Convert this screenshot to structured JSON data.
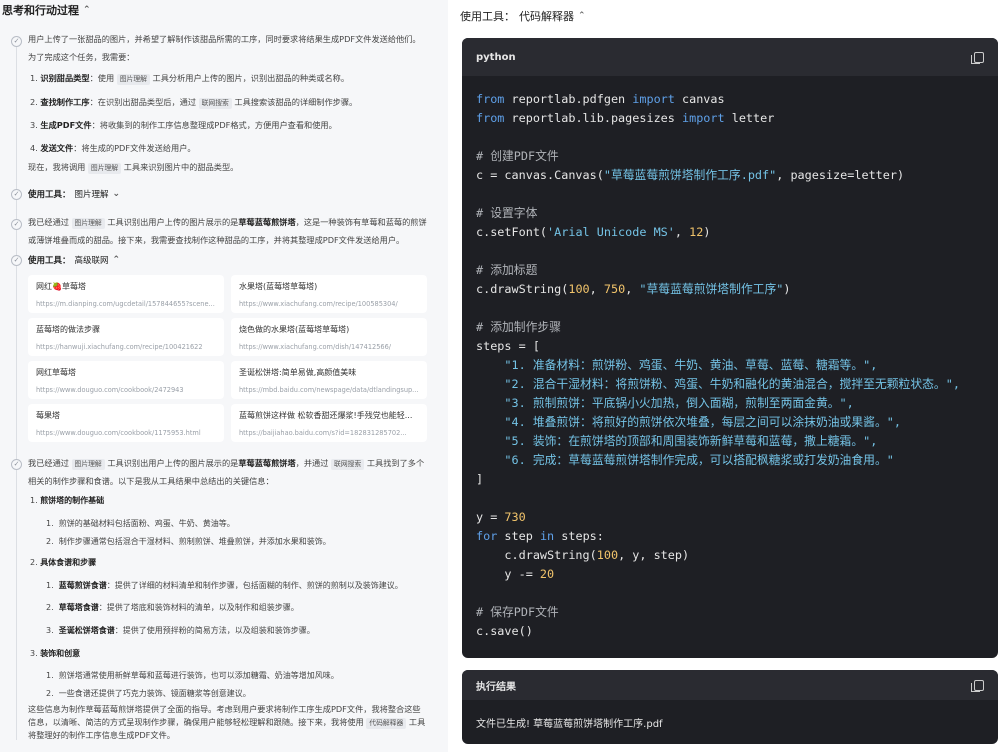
{
  "left": {
    "header": "思考和行动过程",
    "intro": {
      "p1": "用户上传了一张甜品的图片，并希望了解制作该甜品所需的工序，同时要求将结果生成PDF文件发送给他们。",
      "p2": "为了完成这个任务，我需要：",
      "items": [
        {
          "n": "1.",
          "title": "识别甜品类型",
          "pre": "：使用 ",
          "tool": "图片理解",
          "post": " 工具分析用户上传的图片，识别出甜品的种类或名称。"
        },
        {
          "n": "2.",
          "title": "查找制作工序",
          "pre": "：在识别出甜品类型后，通过 ",
          "tool": "联网搜索",
          "post": " 工具搜索该甜品的详细制作步骤。"
        },
        {
          "n": "3.",
          "title": "生成PDF文件",
          "pre": "：将收集到的制作工序信息整理成PDF格式，方便用户查看和使用。",
          "tool": "",
          "post": ""
        },
        {
          "n": "4.",
          "title": "发送文件",
          "pre": "：将生成的PDF文件发送给用户。",
          "tool": "",
          "post": ""
        }
      ],
      "p3_pre": "现在，我将调用 ",
      "p3_tool": "图片理解",
      "p3_post": " 工具来识别图片中的甜品类型。"
    },
    "tool1": {
      "label": "使用工具：",
      "name": "图片理解"
    },
    "recog": {
      "pre": "我已经通过 ",
      "tool": "图片理解",
      "mid": " 工具识别出用户上传的图片展示的是",
      "bold": "草莓蓝莓煎饼塔",
      "post": "，这是一种装饰有草莓和蓝莓的煎饼",
      "line2": "或薄饼堆叠而成的甜品。接下来，我需要查找制作这种甜品的工序，并将其整理成PDF文件发送给用户。"
    },
    "tool2": {
      "label": "使用工具：",
      "name": "高级联网"
    },
    "results": [
      {
        "title": "网红🍓草莓塔",
        "url": "https://m.dianping.com/ugcdetail/157844655?scene..."
      },
      {
        "title": "水果塔(蓝莓塔草莓塔)",
        "url": "https://www.xiachufang.com/recipe/100585304/"
      },
      {
        "title": "蓝莓塔的做法步骤",
        "url": "https://hanwuji.xiachufang.com/recipe/100421622"
      },
      {
        "title": "烧色做的水果塔(蓝莓塔草莓塔)",
        "url": "https://www.xiachufang.com/dish/147412566/"
      },
      {
        "title": "网红草莓塔",
        "url": "https://www.douguo.com/cookbook/2472943"
      },
      {
        "title": "圣诞松饼塔:简单易做,高颜值美味",
        "url": "https://mbd.baidu.com/newspage/data/dtlandingsup..."
      },
      {
        "title": "莓果塔",
        "url": "https://www.douguo.com/cookbook/1175953.html"
      },
      {
        "title": "蓝莓煎饼这样做 松软香甜还爆浆!手残党也能轻...",
        "url": "https://baijiahao.baidu.com/s?id=182831285702..."
      }
    ],
    "summary": {
      "pre": "我已经通过 ",
      "tool1": "图片理解",
      "mid1": " 工具识别出用户上传的图片展示的是",
      "bold": "草莓蓝莓煎饼塔",
      "mid2": "，并通过 ",
      "tool2": "联网搜索",
      "post": " 工具找到了多个",
      "line2": "相关的制作步骤和食谱。以下是我从工具结果中总结出的关键信息：",
      "s1": {
        "n": "1.",
        "title": "煎饼塔的制作基础",
        "items": [
          "煎饼的基础材料包括面粉、鸡蛋、牛奶、黄油等。",
          "制作步骤通常包括混合干湿材料、煎制煎饼、堆叠煎饼，并添加水果和装饰。"
        ]
      },
      "s2": {
        "n": "2.",
        "title": "具体食谱和步骤",
        "items": [
          {
            "title": "蓝莓煎饼食谱",
            "text": "：提供了详细的材料清单和制作步骤，包括面糊的制作、煎饼的煎制以及装饰建议。"
          },
          {
            "title": "草莓塔食谱",
            "text": "：提供了塔底和装饰材料的清单，以及制作和组装步骤。"
          },
          {
            "title": "圣诞松饼塔食谱",
            "text": "：提供了使用预拌粉的简易方法，以及组装和装饰步骤。"
          }
        ]
      },
      "s3": {
        "n": "3.",
        "title": "装饰和创意",
        "items": [
          "煎饼塔通常使用新鲜草莓和蓝莓进行装饰，也可以添加糖霜、奶油等增加风味。",
          "一些食谱还提供了巧克力装饰、镜面糖浆等创意建议。"
        ]
      },
      "final1": "这些信息为制作草莓蓝莓煎饼塔提供了全面的指导。考虑到用户要求将制作工序生成PDF文件，我将整合这些",
      "final2": "信息，以清晰、简洁的方式呈现制作步骤，确保用户能够轻松理解和跟随。接下来，我将使用 ",
      "final2_tool": "代码解释器",
      "final2_post": " 工具",
      "final3": "将整理好的制作工序信息生成PDF文件。"
    }
  },
  "right": {
    "header_label": "使用工具：",
    "header_tool": "代码解释器",
    "code_lang": "python",
    "code": {
      "l1a": "from",
      "l1b": " reportlab.pdfgen ",
      "l1c": "import",
      "l1d": " canvas",
      "l2a": "from",
      "l2b": " reportlab.lib.pagesizes ",
      "l2c": "import",
      "l2d": " letter",
      "c1": "# 创建PDF文件",
      "l3a": "c = canvas.Canvas(",
      "l3b": "\"草莓蓝莓煎饼塔制作工序.pdf\"",
      "l3c": ", pagesize=letter)",
      "c2": "# 设置字体",
      "l4a": "c.setFont(",
      "l4b": "'Arial Unicode MS'",
      "l4c": ", ",
      "l4d": "12",
      "l4e": ")",
      "c3": "# 添加标题",
      "l5a": "c.drawString(",
      "l5b": "100",
      "l5c": ", ",
      "l5d": "750",
      "l5e": ", ",
      "l5f": "\"草莓蓝莓煎饼塔制作工序\"",
      "l5g": ")",
      "c4": "# 添加制作步骤",
      "l6": "steps = [",
      "st": [
        "\"1. 准备材料：煎饼粉、鸡蛋、牛奶、黄油、草莓、蓝莓、糖霜等。\",",
        "\"2. 混合干湿材料：将煎饼粉、鸡蛋、牛奶和融化的黄油混合，搅拌至无颗粒状态。\",",
        "\"3. 煎制煎饼：平底锅小火加热，倒入面糊，煎制至两面金黄。\",",
        "\"4. 堆叠煎饼：将煎好的煎饼依次堆叠，每层之间可以涂抹奶油或果酱。\",",
        "\"5. 装饰：在煎饼塔的顶部和周围装饰新鲜草莓和蓝莓，撒上糖霜。\",",
        "\"6. 完成：草莓蓝莓煎饼塔制作完成，可以搭配枫糖浆或打发奶油食用。\""
      ],
      "l7": "]",
      "l8a": "y = ",
      "l8b": "730",
      "l9a": "for",
      "l9b": " step ",
      "l9c": "in",
      "l9d": " steps:",
      "l10a": "    c.drawString(",
      "l10b": "100",
      "l10c": ", y, step)",
      "l11a": "    y -= ",
      "l11b": "20",
      "c5": "# 保存PDF文件",
      "l12": "c.save()"
    },
    "result_title": "执行结果",
    "result_text": "文件已生成! 草莓蓝莓煎饼塔制作工序.pdf"
  }
}
